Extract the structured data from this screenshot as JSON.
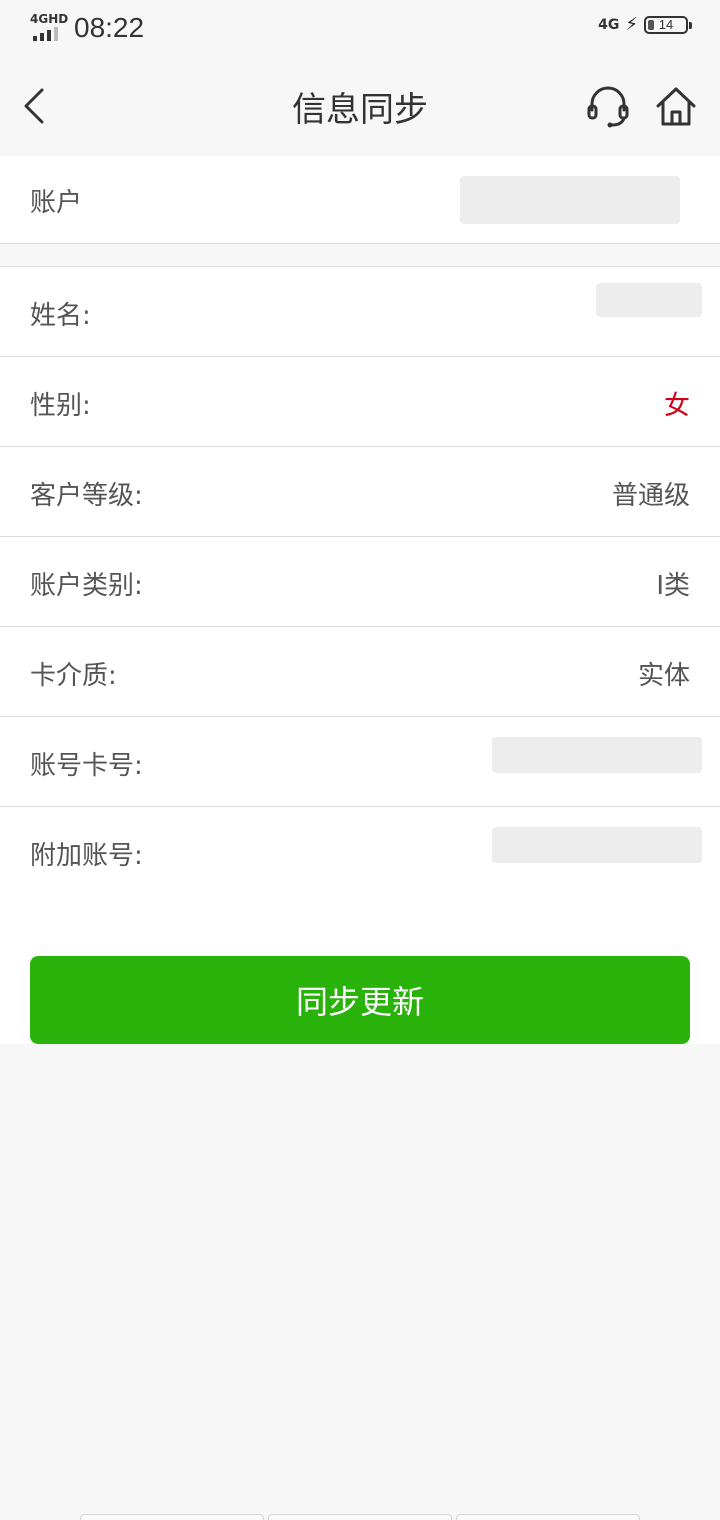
{
  "status_bar": {
    "network": "4GHD",
    "time": "08:22",
    "network_right": "4G",
    "battery_level": "14"
  },
  "nav": {
    "title": "信息同步",
    "icons": {
      "back": "chevron-left-icon",
      "support": "headset-icon",
      "home": "home-icon"
    }
  },
  "account": {
    "label": "账户"
  },
  "fields": [
    {
      "label": "姓名:",
      "value": ""
    },
    {
      "label": "性别:",
      "value": "女"
    },
    {
      "label": "客户等级:",
      "value": "普通级"
    },
    {
      "label": "账户类别:",
      "value": "I类"
    },
    {
      "label": "卡介质:",
      "value": "实体"
    },
    {
      "label": "账号卡号:",
      "value": ""
    },
    {
      "label": "附加账号:",
      "value": ""
    }
  ],
  "actions": {
    "sync_button": "同步更新"
  },
  "colors": {
    "primary_green": "#29b30a",
    "accent_red": "#d0021b",
    "background": "#f7f7f7"
  }
}
